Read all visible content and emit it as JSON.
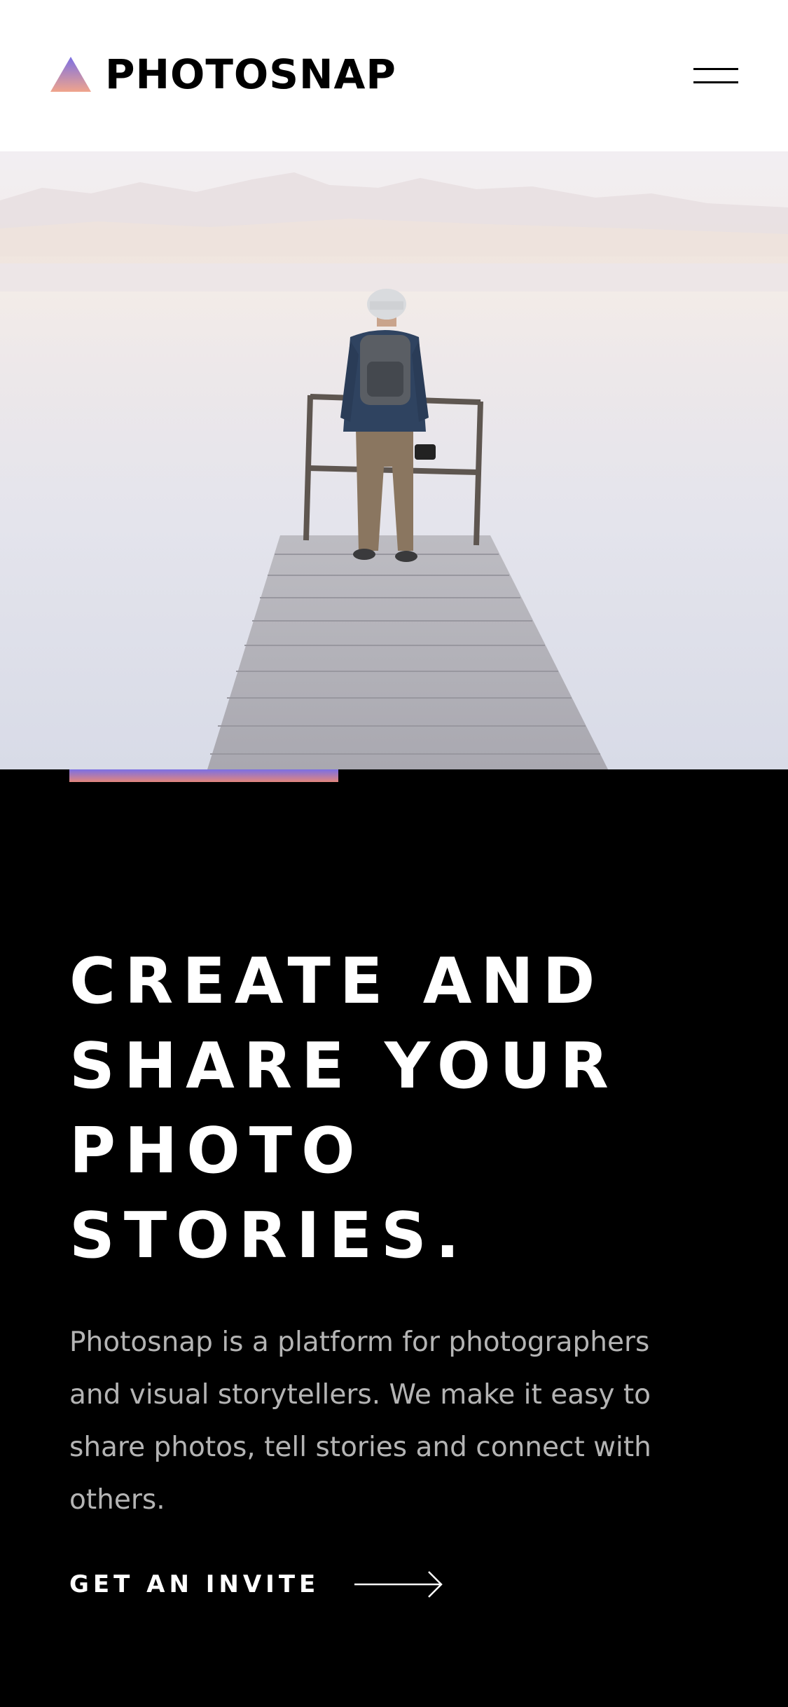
{
  "header": {
    "brand": "PHOTOSNAP",
    "logo_icon": "gradient-triangle-logo",
    "menu_icon": "hamburger-menu-icon"
  },
  "hero": {
    "image": "man with backpack standing on wooden pier overlooking misty lake"
  },
  "colors": {
    "accent_gradient_start": "#7b6fe4",
    "accent_gradient_end": "#e3867c",
    "background": "#000000",
    "header_background": "#ffffff",
    "headline": "#ffffff",
    "body_text": "#b4b4b4"
  },
  "intro": {
    "headline_lines": [
      "CREATE AND",
      "SHARE YOUR",
      "PHOTO",
      "STORIES."
    ],
    "description": "Photosnap is a platform for photographers and visual storytellers. We make it easy to share photos, tell stories and connect with others.",
    "cta_label": "GET AN INVITE",
    "cta_icon": "arrow-right-icon"
  }
}
